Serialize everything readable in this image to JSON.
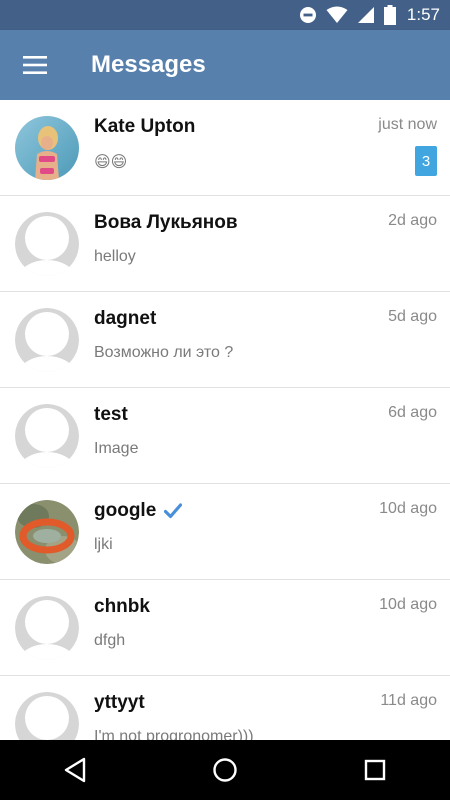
{
  "status_bar": {
    "time": "1:57",
    "icons": [
      "do-not-disturb-icon",
      "wifi-icon",
      "signal-icon",
      "battery-icon"
    ]
  },
  "app_bar": {
    "title": "Messages",
    "menu_icon": "hamburger-menu-icon",
    "color": "#5880ad"
  },
  "conversations": [
    {
      "name": "Kate Upton",
      "time": "just now",
      "preview": "😄😄",
      "unread": "3",
      "avatar": "photo"
    },
    {
      "name": "Вова Лукьянов",
      "time": "2d ago",
      "preview": "helloy",
      "avatar": "placeholder"
    },
    {
      "name": "dagnet",
      "time": "5d ago",
      "preview": "Возможно ли это ?",
      "avatar": "placeholder"
    },
    {
      "name": "test",
      "time": "6d ago",
      "preview": "Image",
      "avatar": "placeholder"
    },
    {
      "name": "google",
      "time": "10d ago",
      "preview": "ljki",
      "avatar": "photo",
      "verified": true
    },
    {
      "name": "chnbk",
      "time": "10d ago",
      "preview": "dfgh",
      "avatar": "placeholder"
    },
    {
      "name": "yttyyt",
      "time": "11d ago",
      "preview": "I'm not progronomer)))",
      "avatar": "placeholder"
    }
  ],
  "badge_color": "#41a6e0",
  "nav_bar": {
    "buttons": [
      "back-icon",
      "home-icon",
      "recents-icon"
    ]
  }
}
